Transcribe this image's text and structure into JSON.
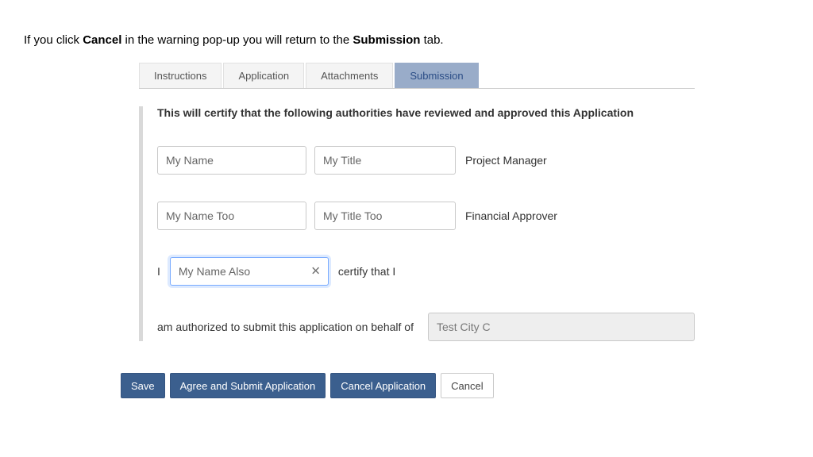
{
  "intro": {
    "p1": "If you click ",
    "b1": "Cancel",
    "p2": " in the warning pop-up you will return to the ",
    "b2": "Submission",
    "p3": " tab."
  },
  "tabs": {
    "instructions": "Instructions",
    "application": "Application",
    "attachments": "Attachments",
    "submission": "Submission"
  },
  "form": {
    "cert_title": "This will certify that the following authorities have reviewed and approved this Application",
    "row1": {
      "name": "My Name",
      "title": "My Title",
      "role": "Project Manager"
    },
    "row2": {
      "name": "My Name Too",
      "title": "My Title Too",
      "role": "Financial Approver"
    },
    "certify": {
      "pre": "I",
      "value": "My Name Also",
      "post": "certify that I"
    },
    "auth": {
      "label": "am authorized to submit this application on behalf of",
      "org": "Test City C"
    }
  },
  "buttons": {
    "save": "Save",
    "agree": "Agree and Submit Application",
    "cancel_app": "Cancel Application",
    "cancel": "Cancel"
  }
}
